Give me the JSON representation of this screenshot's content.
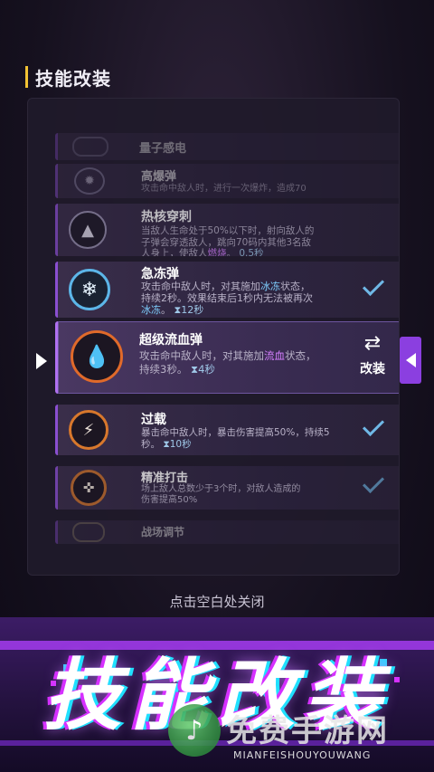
{
  "section": {
    "title": "技能改装"
  },
  "skills": [
    {
      "name": "量子感电",
      "desc1": "",
      "desc2": "",
      "state": "faded-top"
    },
    {
      "name": "高爆弹",
      "desc1": "攻击命中敌人时，进行一次爆炸，造成70",
      "desc2": "",
      "state": "faded"
    },
    {
      "name": "热核穿刺",
      "desc1": "当敌人生命处于50%以下时，射向敌人的",
      "desc2": "子弹会穿透敌人，跳向70码内其他3名敌",
      "desc3_pre": "人身上，使敌人",
      "desc3_hl": "燃烧",
      "desc3_post": "。",
      "cd": "0.5秒"
    },
    {
      "name": "急冻弹",
      "desc1_pre": "攻击命中敌人时，对其施加",
      "desc1_hl": "冰冻",
      "desc1_post": "状态，",
      "desc2": "持续2秒。效果结束后1秒内无法被再次",
      "desc3_hl": "冰冻",
      "desc3_post": "。",
      "cd": "12秒",
      "checked": true
    },
    {
      "name": "超级流血弹",
      "desc1_pre": "攻击命中敌人时，对其施加",
      "desc1_hl": "流血",
      "desc1_post": "状态，",
      "desc2": "持续3秒。",
      "cd": "4秒",
      "action_label": "改装"
    },
    {
      "name": "过载",
      "desc1": "暴击命中敌人时，暴击伤害提高50%，持续5",
      "desc2": "秒。",
      "cd": "10秒",
      "checked": true
    },
    {
      "name": "精准打击",
      "desc1": "场上敌人总数少于3个时，对敌人造成的",
      "desc2": "伤害提高50%",
      "checked": true
    },
    {
      "name": "战场调节",
      "desc1": "",
      "desc2": ""
    }
  ],
  "close_tip": "点击空白处关闭",
  "banner": {
    "title": "技能改装"
  },
  "watermark": {
    "name": "免费手游网",
    "url": "MIANFEISHOUYOUWANG"
  },
  "colors": {
    "accent_purple": "#8b3fe0",
    "highlight_blue": "#7fd0ff",
    "highlight_purple": "#d580ff",
    "title_bar": "#f2c233"
  }
}
